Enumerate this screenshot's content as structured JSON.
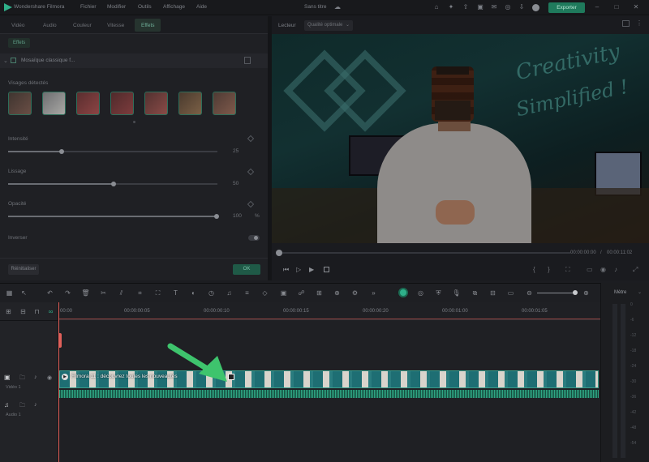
{
  "app": {
    "name": "Wondershare Filmora",
    "doc_title": "Sans titre",
    "menu": [
      "Fichier",
      "Modifier",
      "Outils",
      "Affichage",
      "Aide"
    ],
    "export_label": "Exporter"
  },
  "left_panel": {
    "tabs": [
      "Vidéo",
      "Audio",
      "Couleur",
      "Vitesse",
      "Effets"
    ],
    "active_tab": "Effets",
    "subtab": "Effets",
    "effect_name": "Mosaïque classique f...",
    "faces_label": "Visages détectés",
    "params": [
      {
        "label": "Intensité",
        "value": "25",
        "level": 0.24
      },
      {
        "label": "Lissage",
        "value": "50",
        "level": 0.5
      },
      {
        "label": "Opacité",
        "value": "100",
        "unit": "%",
        "level": 1.0
      }
    ],
    "invert_label": "Inverser",
    "reset_label": "Réinitialiser",
    "ok_label": "OK"
  },
  "preview": {
    "player_label": "Lecteur",
    "quality": "Qualité optimale",
    "current_time": "00:00:00:00",
    "total_time": "00:00:11:02",
    "neon_text": [
      "Creativity",
      "Simplified !"
    ]
  },
  "timeline": {
    "ruler": [
      "00:00",
      "00:00:00:05",
      "00:00:00:10",
      "00:00:00:15",
      "00:00:00:20",
      "00:00:01:00",
      "00:00:01:05"
    ],
    "video_track": "Vidéo 1",
    "audio_track": "Audio 1",
    "clip_title": "Filmora 11 : découvrez toutes les nouveautés",
    "meter_label": "Mètre",
    "meter_scale": [
      "0",
      "-6",
      "-12",
      "-18",
      "-24",
      "-30",
      "-36",
      "-42",
      "-48",
      "-54"
    ]
  },
  "colors": {
    "accent": "#2fb08a",
    "arrow": "#3ec46d",
    "playhead": "#e0605a"
  }
}
